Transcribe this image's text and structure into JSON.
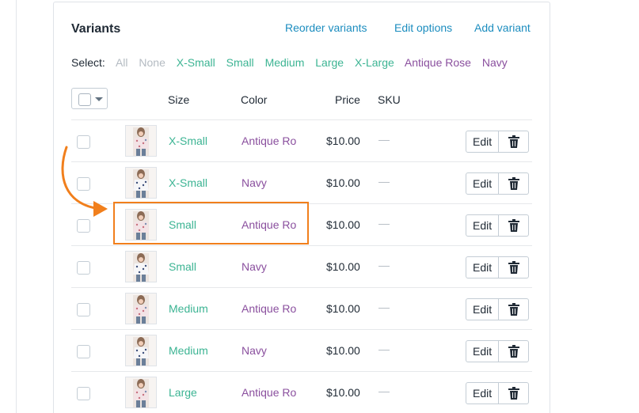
{
  "card": {
    "title": "Variants",
    "actions": {
      "reorder": "Reorder variants",
      "edit_options": "Edit options",
      "add": "Add variant"
    }
  },
  "select": {
    "label": "Select:",
    "all": "All",
    "none": "None",
    "sizes": [
      "X-Small",
      "Small",
      "Medium",
      "Large",
      "X-Large"
    ],
    "colors": [
      "Antique Rose",
      "Navy"
    ]
  },
  "columns": {
    "size": "Size",
    "color": "Color",
    "price": "Price",
    "sku": "SKU"
  },
  "rows": [
    {
      "size": "X-Small",
      "color": "Antique Ro",
      "price": "$10.00",
      "sku": "—",
      "edit": "Edit"
    },
    {
      "size": "X-Small",
      "color": "Navy",
      "price": "$10.00",
      "sku": "—",
      "edit": "Edit"
    },
    {
      "size": "Small",
      "color": "Antique Ro",
      "price": "$10.00",
      "sku": "—",
      "edit": "Edit"
    },
    {
      "size": "Small",
      "color": "Navy",
      "price": "$10.00",
      "sku": "—",
      "edit": "Edit"
    },
    {
      "size": "Medium",
      "color": "Antique Ro",
      "price": "$10.00",
      "sku": "—",
      "edit": "Edit"
    },
    {
      "size": "Medium",
      "color": "Navy",
      "price": "$10.00",
      "sku": "—",
      "edit": "Edit"
    },
    {
      "size": "Large",
      "color": "Antique Ro",
      "price": "$10.00",
      "sku": "—",
      "edit": "Edit"
    }
  ],
  "colors": {
    "size_option": "#3cb493",
    "color_option": "#8a4f9e",
    "link": "#1c8dbf",
    "annotation": "#f17f1c"
  },
  "icons": {
    "delete": "trash-icon",
    "bulk_caret": "chevron-down-icon"
  }
}
